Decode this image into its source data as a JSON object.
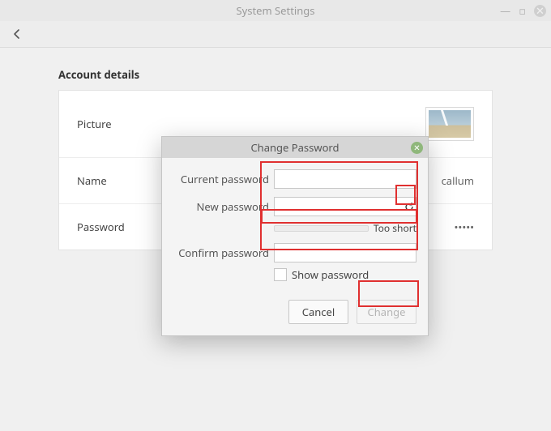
{
  "window": {
    "title": "System Settings"
  },
  "section_title": "Account details",
  "rows": {
    "picture_label": "Picture",
    "name_label": "Name",
    "name_value": "callum",
    "password_label": "Password",
    "password_value": "•••••"
  },
  "dialog": {
    "title": "Change Password",
    "current_label": "Current password",
    "current_value": "",
    "new_label": "New password",
    "new_value": "",
    "strength_text": "Too short",
    "confirm_label": "Confirm password",
    "confirm_value": "",
    "show_password_label": "Show password",
    "show_password_checked": false,
    "cancel_label": "Cancel",
    "change_label": "Change",
    "change_enabled": false
  }
}
